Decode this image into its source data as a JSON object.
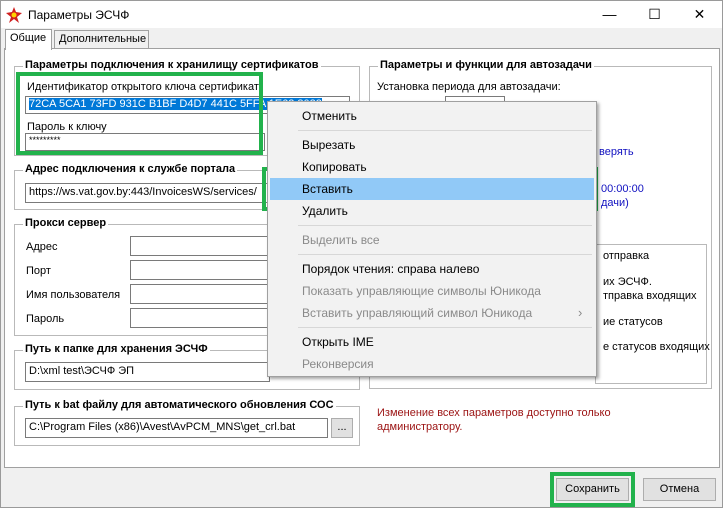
{
  "window": {
    "title": "Параметры ЭСЧФ",
    "minimize_glyph": "—",
    "maximize_glyph": "☐",
    "close_glyph": "✕"
  },
  "tabs": [
    {
      "label": "Общие",
      "active": true
    },
    {
      "label": "Дополнительные",
      "active": false
    }
  ],
  "cert_group": {
    "title": "Параметры подключения к хранилищу сертификатов",
    "key_id_label": "Идентификатор открытого ключа сертификат",
    "key_id_value": "72CA 5CA1 73FD 931C B1BF D4D7 441C 5FFA 1E62 8022",
    "password_label": "Пароль к ключу",
    "password_value": "*********"
  },
  "portal_group": {
    "title": "Адрес подключения к службе портала",
    "url_value": "https://ws.vat.gov.by:443/InvoicesWS/services/"
  },
  "proxy_group": {
    "title": "Прокси сервер",
    "address_label": "Адрес",
    "port_label": "Порт",
    "user_label": "Имя пользователя",
    "password_label": "Пароль"
  },
  "folder_group": {
    "title": "Путь к папке для хранения ЭСЧФ",
    "path_value": "D:\\xml test\\ЭСЧФ ЭП"
  },
  "bat_group": {
    "title": "Путь к bat файлу для автоматического обновления СОС",
    "path_value": "C:\\Program Files (x86)\\Avest\\AvPCM_MNS\\get_crl.bat",
    "browse_label": "..."
  },
  "autotask_group": {
    "title": "Параметры и функции для автозадачи",
    "period_label": "Установка периода для автозадачи:",
    "fragments": [
      "верять",
      "00:00:00",
      "дачи)",
      "отправка",
      "их ЭСЧФ.",
      "тправка входящих",
      "ие статусов",
      "е статусов входящих"
    ]
  },
  "admin_note": "Изменение всех параметров доступно только администратору.",
  "context_menu": {
    "items": [
      {
        "label": "Отменить",
        "disabled": false,
        "selected": false
      },
      {
        "label": "Вырезать",
        "disabled": false,
        "selected": false
      },
      {
        "label": "Копировать",
        "disabled": false,
        "selected": false
      },
      {
        "label": "Вставить",
        "disabled": false,
        "selected": true
      },
      {
        "label": "Удалить",
        "disabled": false,
        "selected": false
      },
      {
        "label": "Выделить все",
        "disabled": true,
        "selected": false
      },
      {
        "label": "Порядок чтения: справа налево",
        "disabled": false,
        "selected": false
      },
      {
        "label": "Показать управляющие символы Юникода",
        "disabled": true,
        "selected": false
      },
      {
        "label": "Вставить управляющий символ Юникода",
        "disabled": true,
        "selected": false
      },
      {
        "label": "Открыть IME",
        "disabled": false,
        "selected": false
      },
      {
        "label": "Реконверсия",
        "disabled": true,
        "selected": false
      }
    ],
    "submenu_arrow": "›"
  },
  "footer": {
    "save_label": "Сохранить",
    "cancel_label": "Отмена"
  },
  "colors": {
    "highlight_border": "#22b24c",
    "menu_selection": "#91c9f7",
    "link_blue": "#1010c0",
    "note_red": "#9b1212",
    "text_selection": "#0078d7"
  }
}
